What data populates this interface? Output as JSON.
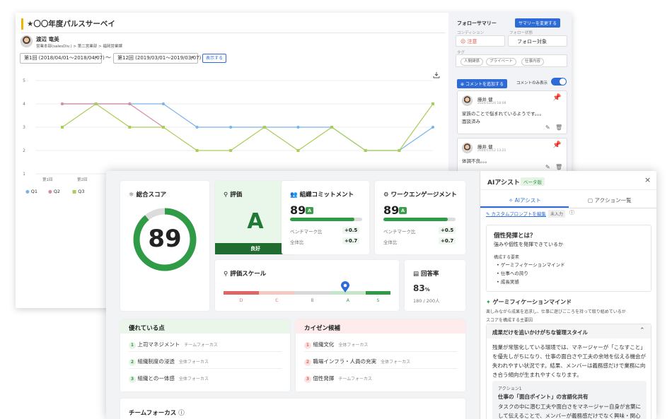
{
  "back": {
    "title": "★〇〇年度パルスサーベイ",
    "user": {
      "name": "渡辺 竜美",
      "dept": "営業本部(salesDiv.) > 第二営業部 > 福岡営業課"
    },
    "period_from": "第1回 (2018/04/01〜2018/04/07)",
    "period_sep": "〜",
    "period_to": "第12回 (2019/03/01〜2019/03/07)",
    "show_button": "表示する",
    "download_icon": "download-icon",
    "chart": {
      "y_ticks": [
        "5",
        "4",
        "3",
        "2",
        "1"
      ],
      "x_ticks": [
        "第1回",
        "第2回"
      ],
      "legend": [
        "Q1",
        "Q2",
        "Q3"
      ]
    },
    "follow": {
      "title": "フォローサマリー",
      "change_button": "サマリーを変更する",
      "condition_label": "コンディション",
      "condition_value": "注意",
      "follow_type_label": "フォロー状態",
      "follow_type_value": "フォロー対象",
      "tags_label": "タグ",
      "tags": [
        "人間関係",
        "プライベート",
        "仕事内容"
      ],
      "add_comment": "コメントを追加する",
      "comment_only": "コメントのみ表示"
    },
    "comments": [
      {
        "author": "藤井 健",
        "date": "2020/12/24 18:08",
        "text": "家族のことで悩まれているようです。。。",
        "text2": "面談済み"
      },
      {
        "author": "藤井 健",
        "date": "2020/11/12 13:21",
        "text": "体調不良。。。",
        "text2": ""
      }
    ]
  },
  "chart_data": {
    "type": "line",
    "categories": [
      "第1回",
      "第2回",
      "",
      "",
      "",
      "",
      "",
      "",
      "",
      "",
      "",
      ""
    ],
    "ylim": [
      1,
      5
    ],
    "series": [
      {
        "name": "Q1",
        "color": "#7ab2ea",
        "values": [
          4,
          4,
          4,
          4,
          3,
          3,
          3,
          3,
          3,
          2,
          2,
          3
        ]
      },
      {
        "name": "Q2",
        "color": "#d98aa5",
        "values": [
          4,
          4,
          4,
          3,
          null,
          null,
          null,
          null,
          null,
          null,
          null,
          null
        ]
      },
      {
        "name": "Q3",
        "color": "#a9cd5a",
        "values": [
          3,
          4,
          3,
          3,
          2,
          2,
          3,
          2,
          3,
          2,
          2,
          4
        ]
      }
    ],
    "xlabel": "",
    "ylabel": ""
  },
  "summary": {
    "total_title": "総合スコア",
    "total_score": "89",
    "total_fraction": 0.89,
    "eval_title": "評価",
    "eval_grade": "A",
    "eval_label": "良好",
    "commit": {
      "title": "組織コミットメント",
      "score": "89",
      "grade": "A",
      "fill": 0.89,
      "bench_label": "ベンチマーク比",
      "bench_value": "+0.5",
      "all_label": "全体比",
      "all_value": "+0.7"
    },
    "engage": {
      "title": "ワークエンゲージメント",
      "score": "89",
      "grade": "A",
      "fill": 0.89,
      "bench_label": "ベンチマーク比",
      "bench_value": "+0.5",
      "all_label": "全体比",
      "all_value": "+0.7"
    },
    "scale": {
      "title": "評価スケール",
      "labels": [
        "D",
        "C",
        "B",
        "A",
        "S"
      ],
      "marker_fraction": 0.73
    },
    "response": {
      "title": "回答率",
      "rate": "83",
      "unit": "%",
      "detail": "180 / 200人"
    },
    "strengths": {
      "title": "優れている点",
      "items": [
        {
          "n": "1",
          "label": "上司マネジメント",
          "sub": "チームフォーカス"
        },
        {
          "n": "2",
          "label": "組織制度の浸透",
          "sub": "全体フォーカス"
        },
        {
          "n": "3",
          "label": "組織との一体感",
          "sub": "全体フォーカス"
        }
      ]
    },
    "improve": {
      "title": "カイゼン候補",
      "items": [
        {
          "n": "1",
          "label": "組織文化",
          "sub": "全体フォーカス"
        },
        {
          "n": "2",
          "label": "職場インフラ・人員の充実",
          "sub": "全体フォーカス"
        },
        {
          "n": "3",
          "label": "個性発揮",
          "sub": "チームフォーカス"
        }
      ]
    },
    "team_focus": "チームフォーカス"
  },
  "ai": {
    "title": "AIアシスト",
    "beta": "ベータ版",
    "tab_ai": "AIアシスト",
    "tab_actions": "アクション一覧",
    "custom_prompt": "カスタムプロンプトを編集",
    "not_entered": "未入力",
    "q_title": "個性発揮とは？",
    "q_desc": "強みや個性を発揮できているか",
    "elements_label": "構成する要素",
    "elements": [
      "ゲーミフィケーションマインド",
      "仕事への誇り",
      "成長実感"
    ],
    "gm_title": "ゲーミフィケーションマインド",
    "gm_desc": "楽しみながら成果を追求し、仕事に遊びごころを持って取り組めているか",
    "cause_label": "スコアを構成する主要因",
    "acc_title": "成果だけを追いかけがちな管理スタイル",
    "acc_body": "残業が常態化している環境では、マネージャーが「こなすこと」を優先しがちになり、仕事の面白さや工夫の余地を伝える機会が失われやすい状況です。結果、メンバーは義務感だけで業務に向き合う傾向が生まれやすくなります。",
    "action_label": "アクション1",
    "action_title": "仕事の「面白ポイント」の言語化共有",
    "action_body": "タスクの中に潜む工夫や面白さをマネージャー自身が言葉にして伝えることで、メンバーが義務感だけでなく興味・関心を"
  }
}
